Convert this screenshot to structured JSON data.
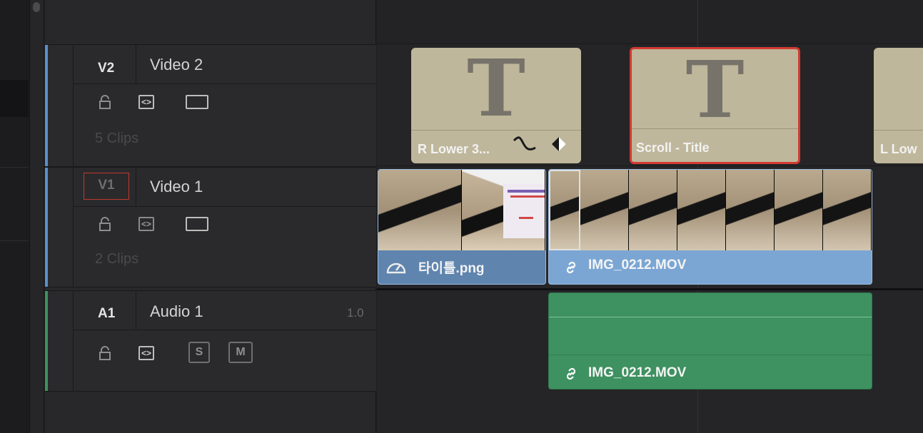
{
  "tracks": {
    "v2": {
      "code": "V2",
      "name": "Video 2",
      "clip_count": "5 Clips",
      "accent": "#5b8fc9"
    },
    "v1": {
      "code": "V1",
      "name": "Video 1",
      "clip_count": "2 Clips",
      "accent": "#5b8fc9"
    },
    "a1": {
      "code": "A1",
      "name": "Audio 1",
      "level": "1.0",
      "solo": "S",
      "mute": "M",
      "accent": "#3e9160"
    }
  },
  "clips": {
    "v2_left": {
      "label": "R Lower 3..."
    },
    "v2_selected": {
      "label": "Scroll - Title"
    },
    "v2_right": {
      "label": "L Low"
    },
    "v1_image": {
      "label": "타이틀.png"
    },
    "v1_video": {
      "label": "IMG_0212.MOV"
    },
    "a1_audio": {
      "label": "IMG_0212.MOV"
    }
  },
  "icons": {
    "lock": "lock-icon",
    "auto_select": "auto-select-icon",
    "monitor": "track-monitor-icon",
    "link": "link-icon",
    "speed": "speed-icon",
    "keyframe_curve": "keyframe-curve-icon",
    "keyframe": "keyframe-diamond-icon"
  },
  "colors": {
    "title_clip": "#bfb79b",
    "video_clip": "#5f84ae",
    "audio_clip": "#3e9160",
    "selection": "#d33a32"
  }
}
